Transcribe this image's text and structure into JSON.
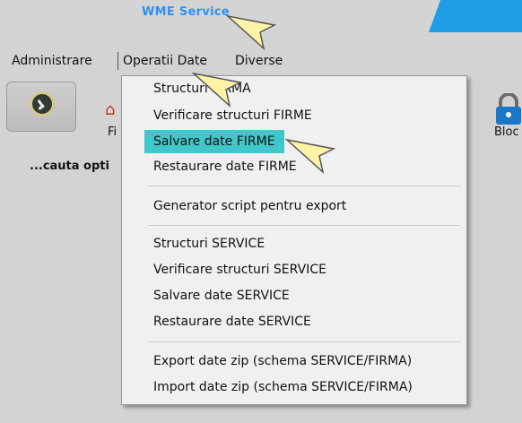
{
  "app": {
    "title": "WME Service"
  },
  "menubar": {
    "items": [
      "Administrare",
      "Operatii Date",
      "Diverse"
    ]
  },
  "toolbar": {
    "fi_label": "Fi",
    "bloc_label": "Bloc"
  },
  "search": {
    "text": "...cauta opti"
  },
  "dropdown": {
    "items": [
      "Structuri FIRMA",
      "Verificare structuri FIRME",
      "Salvare date FIRME",
      "Restaurare date FIRME",
      "Generator script pentru export",
      "Structuri SERVICE",
      "Verificare structuri SERVICE",
      "Salvare date SERVICE",
      "Restaurare date SERVICE",
      "Export date zip (schema SERVICE/FIRMA)",
      "Import date zip (schema SERVICE/FIRMA)"
    ],
    "highlighted_index": 2
  },
  "colors": {
    "accent": "#3fc7c9",
    "tab": "#1f9ee7",
    "title": "#2e8ff5"
  },
  "icons": [
    "clock-icon",
    "home-icon",
    "lock-icon",
    "cursor-arrow-icon"
  ]
}
